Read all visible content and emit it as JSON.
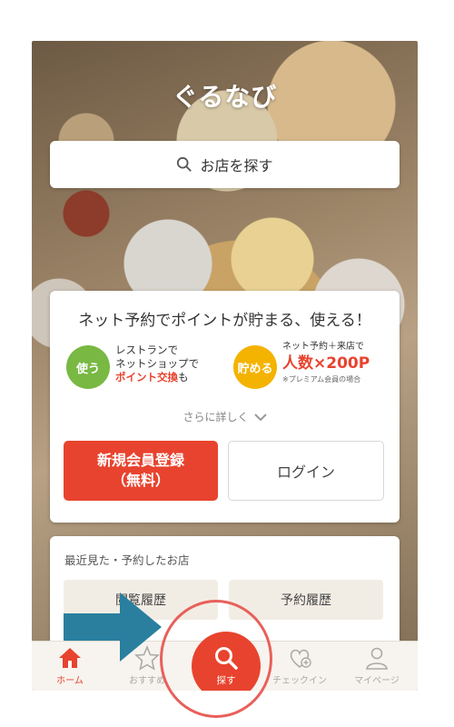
{
  "app": {
    "logo": "ぐるなび"
  },
  "search": {
    "label": "お店を探す"
  },
  "promo": {
    "title": "ネット予約でポイントが貯まる、使える！",
    "use_badge": "使う",
    "use_line1": "レストランで",
    "use_line2": "ネットショップで",
    "use_highlight": "ポイント交換",
    "use_suffix": "も",
    "save_badge": "貯める",
    "save_line1": "ネット予約＋来店で",
    "save_big": "人数×200P",
    "save_note": "※プレミアム会員の場合",
    "more": "さらに詳しく",
    "register_line1": "新規会員登録",
    "register_line2": "（無料）",
    "login": "ログイン"
  },
  "recent": {
    "title": "最近見た・予約したお店",
    "history_button": "閲覧履歴",
    "reservation_button": "予約履歴"
  },
  "tabs": {
    "home": "ホーム",
    "recommend": "おすすめ",
    "search": "探す",
    "check": "チェックイン",
    "mypage": "マイページ"
  },
  "colors": {
    "accent": "#e8432e",
    "green": "#79b843",
    "yellow": "#f4b300",
    "arrow": "#2a7f9e"
  }
}
